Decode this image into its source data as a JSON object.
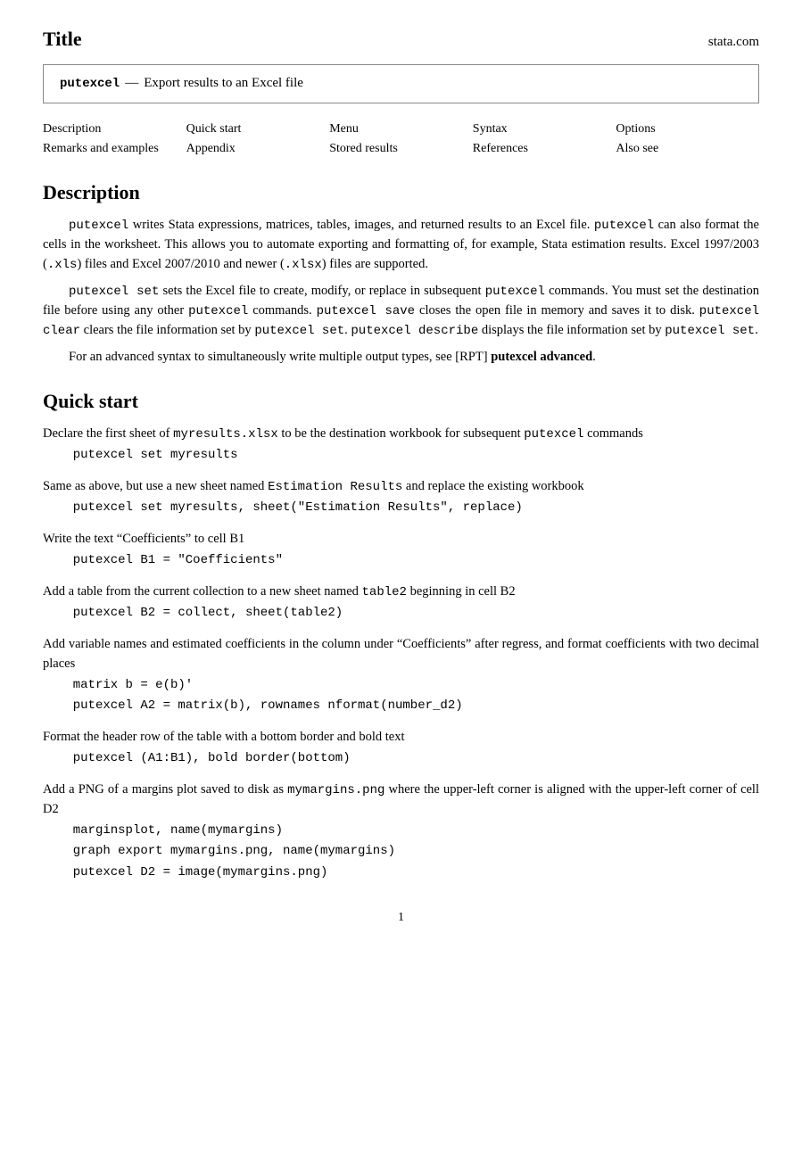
{
  "header": {
    "title": "Title",
    "stata_com": "stata.com"
  },
  "title_box": {
    "command": "putexcel",
    "separator": "—",
    "description": "Export results to an Excel file"
  },
  "nav": {
    "rows": [
      [
        "Description",
        "Quick start",
        "Menu",
        "Syntax",
        "Options"
      ],
      [
        "Remarks and examples",
        "Appendix",
        "Stored results",
        "References",
        "Also see"
      ]
    ]
  },
  "description": {
    "heading": "Description",
    "paragraphs": [
      "putexcel writes Stata expressions, matrices, tables, images, and returned results to an Excel file. putexcel can also format the cells in the worksheet. This allows you to automate exporting and formatting of, for example, Stata estimation results. Excel 1997/2003 (.xls) files and Excel 2007/2010 and newer (.xlsx) files are supported.",
      "putexcel set sets the Excel file to create, modify, or replace in subsequent putexcel commands. You must set the destination file before using any other putexcel commands. putexcel save closes the open file in memory and saves it to disk. putexcel clear clears the file information set by putexcel set. putexcel describe displays the file information set by putexcel set.",
      "For an advanced syntax to simultaneously write multiple output types, see [RPT] putexcel advanced."
    ]
  },
  "quick_start": {
    "heading": "Quick start",
    "items": [
      {
        "desc": "Declare the first sheet of myresults.xlsx to be the destination workbook for subsequent putexcel commands",
        "codes": [
          "putexcel set myresults"
        ]
      },
      {
        "desc": "Same as above, but use a new sheet named Estimation Results and replace the existing workbook",
        "codes": [
          "putexcel set myresults, sheet(\"Estimation Results\", replace)"
        ]
      },
      {
        "desc": "Write the text “Coefficients” to cell B1",
        "codes": [
          "putexcel B1 = \"Coefficients\""
        ]
      },
      {
        "desc": "Add a table from the current collection to a new sheet named table2 beginning in cell B2",
        "codes": [
          "putexcel B2 = collect, sheet(table2)"
        ]
      },
      {
        "desc": "Add variable names and estimated coefficients in the column under “Coefficients” after regress, and format coefficients with two decimal places",
        "codes": [
          "matrix b = e(b)'",
          "putexcel A2 = matrix(b), rownames nformat(number_d2)"
        ]
      },
      {
        "desc": "Format the header row of the table with a bottom border and bold text",
        "codes": [
          "putexcel (A1:B1), bold border(bottom)"
        ]
      },
      {
        "desc": "Add a PNG of a margins plot saved to disk as mymargins.png where the upper-left corner is aligned with the upper-left corner of cell D2",
        "codes": [
          "marginsplot, name(mymargins)",
          "graph export mymargins.png, name(mymargins)",
          "putexcel D2 = image(mymargins.png)"
        ]
      }
    ]
  },
  "footer": {
    "page_number": "1"
  }
}
